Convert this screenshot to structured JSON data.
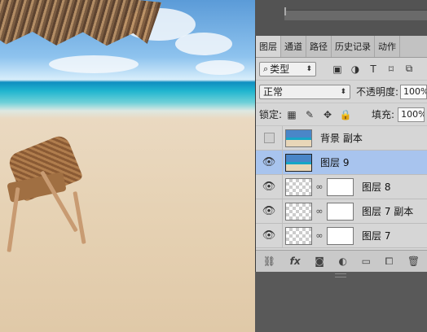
{
  "tabs": [
    "图层",
    "通道",
    "路径",
    "历史记录",
    "动作"
  ],
  "filter": {
    "label": "类型",
    "icon": "search-icon"
  },
  "blend_mode": "正常",
  "opacity": {
    "label": "不透明度:",
    "value": "100%"
  },
  "lock": {
    "label": "锁定:"
  },
  "fill": {
    "label": "填充:",
    "value": "100%"
  },
  "layers": [
    {
      "name": "背景 副本",
      "visible": false,
      "selected": false
    },
    {
      "name": "图层 9",
      "visible": true,
      "selected": true
    },
    {
      "name": "图层 8",
      "visible": true,
      "selected": false
    },
    {
      "name": "图层 7 副本",
      "visible": true,
      "selected": false
    },
    {
      "name": "图层 7",
      "visible": true,
      "selected": false
    }
  ],
  "footer_icons": [
    "link-icon",
    "fx-icon",
    "mask-icon",
    "adjustment-icon",
    "folder-icon",
    "new-layer-icon",
    "trash-icon"
  ],
  "footer": {
    "fx": "fx"
  },
  "colors": {
    "selected_row": "#a8c4ee",
    "panel_bg": "#d6d6d6"
  }
}
